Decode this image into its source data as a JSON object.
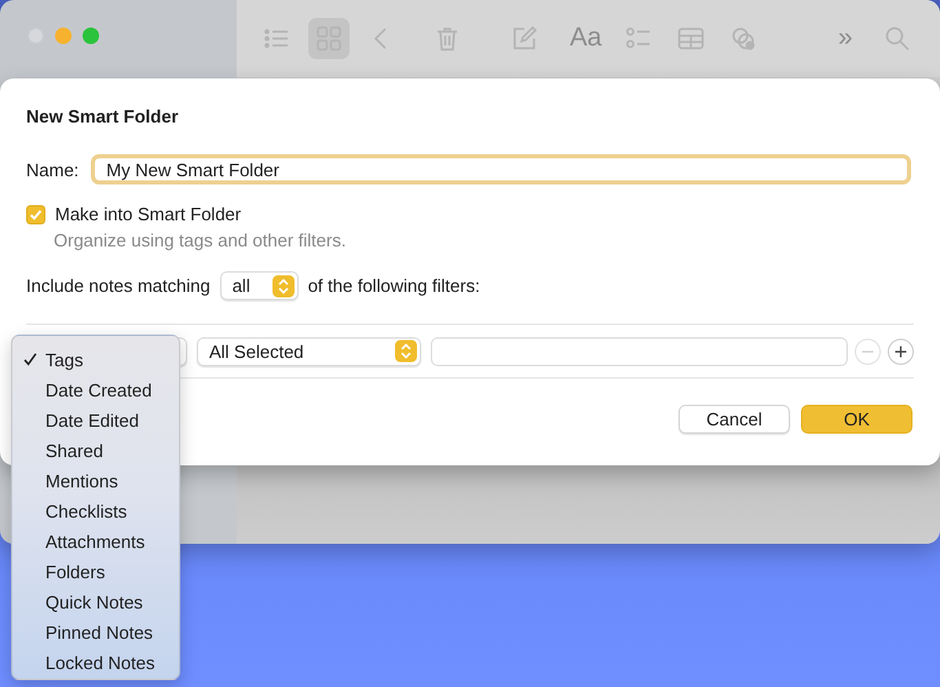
{
  "toolbar": [
    {
      "kind": "list",
      "selected": false
    },
    {
      "kind": "grid",
      "selected": true
    },
    {
      "kind": "back",
      "selected": false
    },
    {
      "kind": "trash",
      "selected": false
    },
    {
      "kind": "compose",
      "selected": false
    },
    {
      "kind": "font",
      "label": "Aa",
      "selected": false
    },
    {
      "kind": "checklist",
      "selected": false
    },
    {
      "kind": "table",
      "selected": false
    },
    {
      "kind": "collaborate",
      "selected": false
    },
    {
      "kind": "more",
      "label": "»",
      "selected": false
    },
    {
      "kind": "search",
      "selected": false
    }
  ],
  "dialog": {
    "title": "New Smart Folder",
    "name_label": "Name:",
    "name_value": "My New Smart Folder",
    "smart_folder": {
      "label": "Make into Smart Folder",
      "checked": true,
      "description": "Organize using tags and other filters."
    },
    "include": {
      "prefix": "Include notes matching",
      "match_value": "all",
      "suffix": "of the following filters:"
    },
    "filter": {
      "value_popup": "All Selected"
    },
    "buttons": [
      {
        "label": "Cancel",
        "kind": "cancel"
      },
      {
        "label": "OK",
        "kind": "default"
      }
    ]
  },
  "menu": {
    "items": [
      {
        "label": "Tags",
        "selected": true
      },
      {
        "label": "Date Created",
        "selected": false
      },
      {
        "label": "Date Edited",
        "selected": false
      },
      {
        "label": "Shared",
        "selected": false
      },
      {
        "label": "Mentions",
        "selected": false
      },
      {
        "label": "Checklists",
        "selected": false
      },
      {
        "label": "Attachments",
        "selected": false
      },
      {
        "label": "Folders",
        "selected": false
      },
      {
        "label": "Quick Notes",
        "selected": false
      },
      {
        "label": "Pinned Notes",
        "selected": false
      },
      {
        "label": "Locked Notes",
        "selected": false
      }
    ]
  }
}
